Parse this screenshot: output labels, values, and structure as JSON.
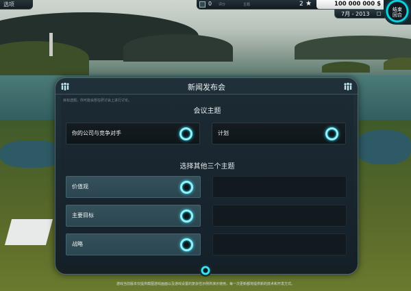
{
  "top_left_button": "选项",
  "hud": {
    "count": "0",
    "label_a": "评分",
    "label_b": "主题",
    "rank": "2",
    "star_icon": "star-icon",
    "money": "100 000 000 $",
    "date": "7月 - 2013"
  },
  "end_button": "结束\n回合",
  "dialog": {
    "title": "新闻发布会",
    "hint": "目标选题，你可能会想在研讨会上进行讨论。",
    "section1_title": "会议主题",
    "topic_slots": [
      {
        "label": "你的公司与竞争对手"
      },
      {
        "label": "计划"
      }
    ],
    "section2_title": "选择其他三个主题",
    "other_slots": [
      {
        "label": "价值观"
      },
      {
        "label": "主要目标"
      },
      {
        "label": "战略"
      }
    ]
  },
  "footer": "游戏当前版本仅提供截图游戏画面以及游戏设置的复杂性示例供演示使用，每一次更新都将提供新的技术和开发方式。",
  "colors": {
    "accent": "#37e3f5",
    "panel": "#1f2e38",
    "money_bg": "#f2f2f2"
  }
}
